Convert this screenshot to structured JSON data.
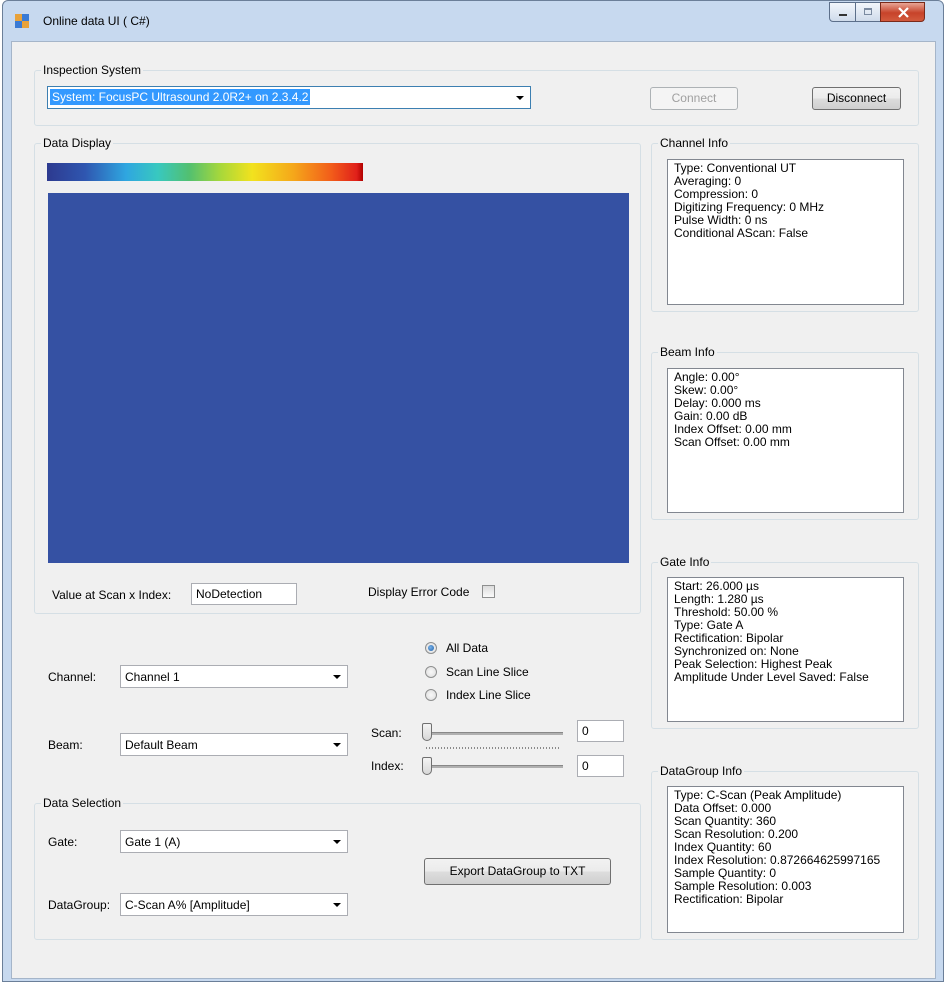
{
  "window": {
    "title": "Online data UI ( C#)"
  },
  "inspection_system": {
    "legend": "Inspection System",
    "system_value": "System:  FocusPC Ultrasound 2.0R2+ on 2.3.4.2",
    "connect_label": "Connect",
    "disconnect_label": "Disconnect"
  },
  "data_display": {
    "legend": "Data Display",
    "value_label": "Value at Scan x Index:",
    "value": "NoDetection",
    "error_code_label": "Display Error Code",
    "error_code_checked": false,
    "plot_color": "#3551a3"
  },
  "controls": {
    "channel_label": "Channel:",
    "channel_value": "Channel 1",
    "beam_label": "Beam:",
    "beam_value": "Default Beam",
    "radios": [
      "All Data",
      "Scan Line Slice",
      "Index Line Slice"
    ],
    "selected_radio": "All Data",
    "scan_label": "Scan:",
    "scan_value": "0",
    "index_label": "Index:",
    "index_value": "0"
  },
  "data_selection": {
    "legend": "Data Selection",
    "gate_label": "Gate:",
    "gate_value": "Gate 1 (A)",
    "datagroup_label": "DataGroup:",
    "datagroup_value": "C-Scan A% [Amplitude]",
    "export_label": "Export DataGroup to TXT"
  },
  "channel_info": {
    "legend": "Channel Info",
    "lines": [
      "Type: Conventional UT",
      "Averaging: 0",
      "Compression: 0",
      "Digitizing Frequency: 0 MHz",
      "Pulse Width: 0 ns",
      "Conditional AScan: False"
    ]
  },
  "beam_info": {
    "legend": "Beam Info",
    "lines": [
      "Angle: 0.00°",
      "Skew: 0.00°",
      "Delay: 0.000 ms",
      "Gain: 0.00 dB",
      "Index Offset: 0.00 mm",
      "Scan Offset: 0.00 mm"
    ]
  },
  "gate_info": {
    "legend": "Gate Info",
    "lines": [
      "Start: 26.000 µs",
      "Length: 1.280 µs",
      "Threshold: 50.00 %",
      "Type: Gate A",
      "Rectification: Bipolar",
      "Synchronized on: None",
      "Peak Selection: Highest Peak",
      "Amplitude Under Level Saved: False"
    ]
  },
  "datagroup_info": {
    "legend": "DataGroup Info",
    "lines": [
      "Type: C-Scan (Peak Amplitude)",
      "Data Offset: 0.000",
      "Scan Quantity: 360",
      "Scan Resolution: 0.200",
      "Index Quantity: 60",
      "Index Resolution: 0.872664625997165",
      "Sample Quantity: 0",
      "Sample Resolution: 0.003",
      "Rectification: Bipolar"
    ]
  }
}
